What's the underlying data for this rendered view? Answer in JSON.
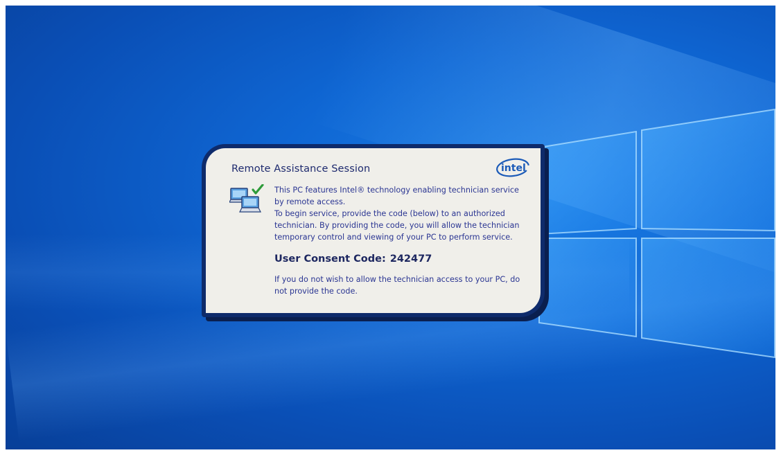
{
  "desktop": {
    "background_color": "#0f67d4",
    "logo_icon": "windows-logo-icon"
  },
  "dialog": {
    "title": "Remote Assistance Session",
    "brand_icon": "intel-logo-icon",
    "brand_text": "intel",
    "illustration_icon": "remote-computers-check-icon",
    "body_line_1": "This PC features Intel® technology enabling technician service by remote access.",
    "body_line_2": "To begin service, provide the code (below) to an authorized technician.  By providing the code, you will allow the technician temporary control and viewing of your PC to perform service.",
    "consent_label": "User Consent Code:",
    "consent_code": "242477",
    "footer_text": "If you do not wish to allow the technician access to your PC, do not provide the code.",
    "border_color": "#0e2b6b",
    "panel_color": "#f0efea",
    "text_color": "#2a3592"
  }
}
